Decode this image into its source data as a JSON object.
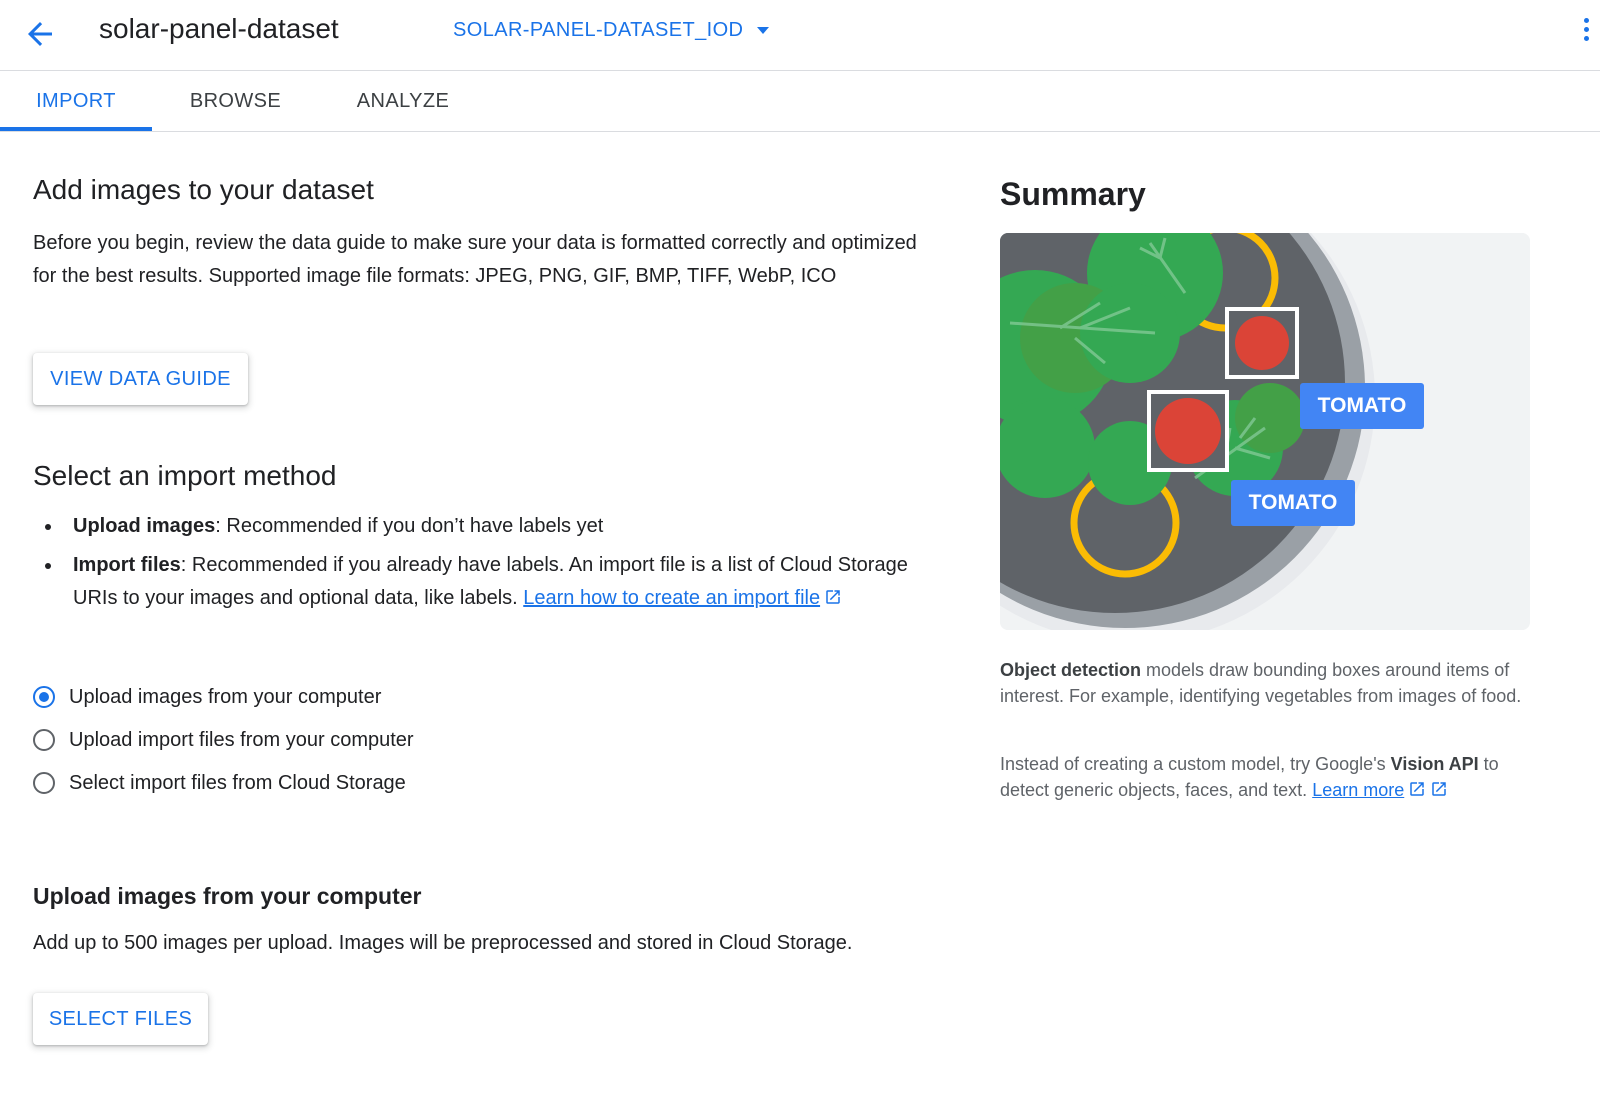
{
  "header": {
    "title": "solar-panel-dataset",
    "version_selector": "SOLAR-PANEL-DATASET_IOD"
  },
  "tabs": [
    {
      "label": "IMPORT",
      "active": true
    },
    {
      "label": "BROWSE",
      "active": false
    },
    {
      "label": "ANALYZE",
      "active": false
    }
  ],
  "add_images": {
    "heading": "Add images to your dataset",
    "description": "Before you begin, review the data guide to make sure your data is formatted correctly and optimized for the best results. Supported image file formats: JPEG, PNG, GIF, BMP, TIFF, WebP, ICO",
    "view_guide_button": "VIEW DATA GUIDE"
  },
  "import_method": {
    "heading": "Select an import method",
    "bullets": [
      {
        "bold": "Upload images",
        "text": ": Recommended if you don’t have labels yet"
      },
      {
        "bold": "Import files",
        "text": ": Recommended if you already have labels. An import file is a list of Cloud Storage URIs to your images and optional data, like labels. ",
        "link": "Learn how to create an import file"
      }
    ],
    "options": [
      {
        "label": "Upload images from your computer",
        "selected": true
      },
      {
        "label": "Upload import files from your computer",
        "selected": false
      },
      {
        "label": "Select import files from Cloud Storage",
        "selected": false
      }
    ]
  },
  "upload": {
    "heading": "Upload images from your computer",
    "description": "Add up to 500 images per upload. Images will be preprocessed and stored in Cloud Storage.",
    "select_files_button": "SELECT FILES"
  },
  "summary": {
    "title": "Summary",
    "illustration_labels": [
      "TOMATO",
      "TOMATO"
    ],
    "para1_bold": "Object detection",
    "para1_text": " models draw bounding boxes around items of interest. For example, identifying vegetables from images of food.",
    "para2_text": "Instead of creating a custom model, try Google's ",
    "para2_bold": "Vision API",
    "para2_text2": " to detect generic objects, faces, and text. ",
    "learn_more": "Learn more"
  },
  "colors": {
    "accent": "#1a73e8",
    "tomato": "#db4437",
    "leaf": "#34a853",
    "ring": "#fbbc04",
    "bowl": "#5f6368"
  }
}
